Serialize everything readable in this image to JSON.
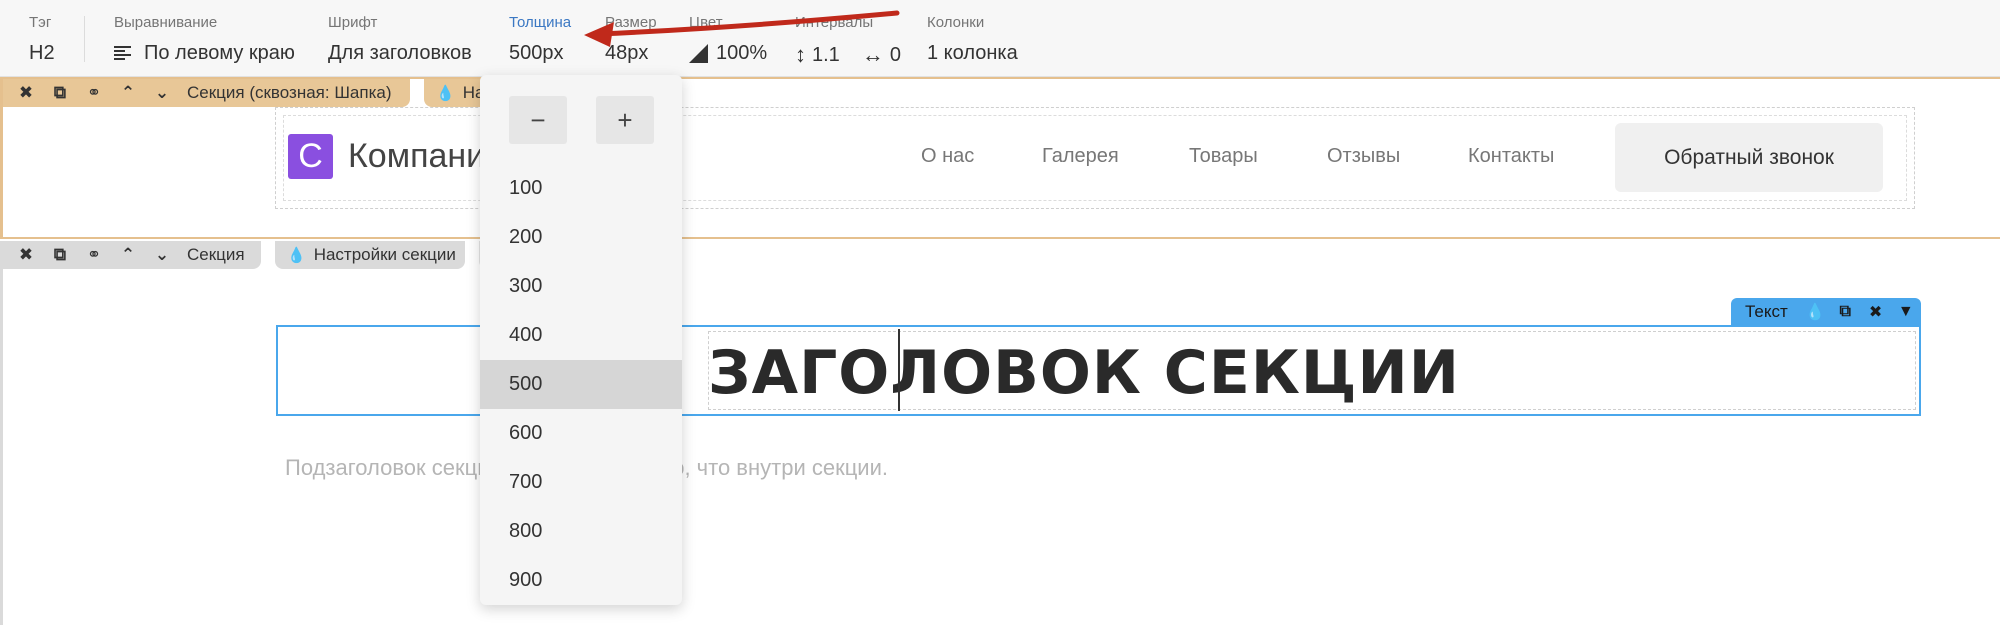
{
  "toolbar": {
    "tag": {
      "label": "Тэг",
      "value": "H2"
    },
    "align": {
      "label": "Выравнивание",
      "value": "По левому краю",
      "icon": "align-left-icon"
    },
    "font": {
      "label": "Шрифт",
      "value": "Для заголовков"
    },
    "weight": {
      "label": "Толщина",
      "value": "500px"
    },
    "size": {
      "label": "Размер",
      "value": "48px"
    },
    "color": {
      "label": "Цвет",
      "value": "100%",
      "icon": "opacity-triangle-icon"
    },
    "intervals": {
      "label": "Интервалы",
      "line_height": "1.1",
      "letter_spacing": "0",
      "icons": [
        "line-height-icon",
        "letter-spacing-icon"
      ]
    },
    "columns": {
      "label": "Колонки",
      "value": "1 колонка"
    }
  },
  "header_section": {
    "bar_label": "Секция (сквозная: Шапка)",
    "settings_label": "На",
    "buttons": [
      "close-icon",
      "duplicate-icon",
      "link-icon",
      "move-up-icon",
      "move-down-icon"
    ],
    "logo_letter": "C",
    "brand": "Компания",
    "nav": [
      "О нас",
      "Галерея",
      "Товары",
      "Отзывы",
      "Контакты"
    ],
    "cta": "Обратный звонок"
  },
  "main_section": {
    "bar_label": "Секция",
    "settings_label": "Настройки секции",
    "text_toolbar_label": "Текст",
    "heading": "ЗАГОЛОВОК СЕКЦИИ",
    "subheading": "Подзаголовок секции с описанием того, что внутри секции."
  },
  "weight_dropdown": {
    "minus": "−",
    "plus": "+",
    "options": [
      "100",
      "200",
      "300",
      "400",
      "500",
      "600",
      "700",
      "800",
      "900"
    ],
    "selected": "500"
  },
  "colors": {
    "header_accent": "#e8c797",
    "selection_blue": "#4aa7ec",
    "logo_purple": "#8a4fe0",
    "annotation_red": "#c0291b"
  }
}
